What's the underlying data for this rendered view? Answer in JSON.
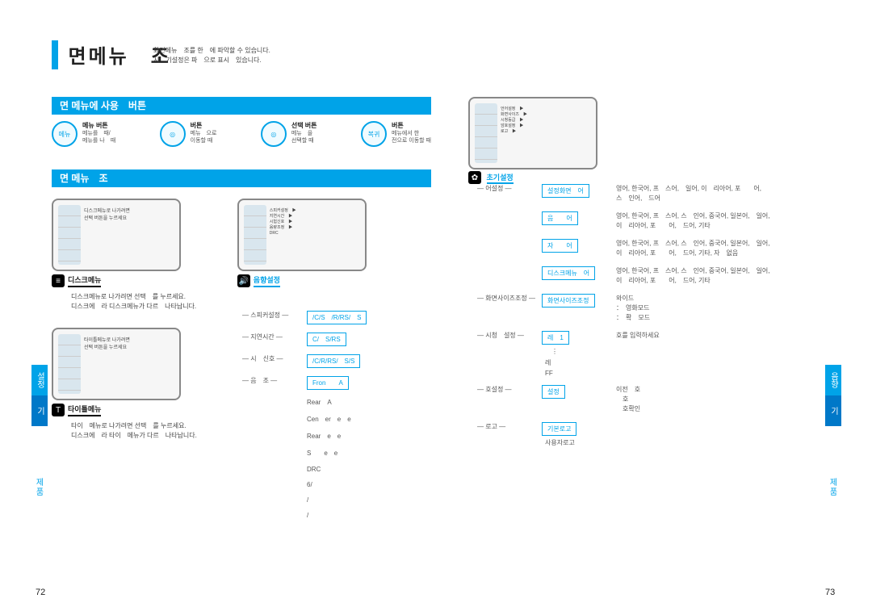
{
  "title": {
    "main": "면메뉴　조",
    "sub1": "화면메뉴　조를 한　에 파악할 수 있습니다.",
    "sub2": "시　기설정은 파　으로 표시　있습니다."
  },
  "section1": {
    "heading": "면 메뉴에 사용　버튼",
    "items": [
      {
        "icon": "메뉴",
        "title": "메뉴 버튼",
        "line1": "메뉴를　때/",
        "line2": "메뉴를 나　때"
      },
      {
        "icon": "◎",
        "title": "버튼",
        "line1": "메뉴　으로",
        "line2": "이동할 때"
      },
      {
        "icon": "◎",
        "title": "선택 버튼",
        "line1": "메뉴　을",
        "line2": "선택할 때"
      },
      {
        "icon": "복귀",
        "title": "버튼",
        "line1": "메뉴에서 한",
        "line2": "전으로 이동할 때"
      }
    ]
  },
  "section2": {
    "heading": "면 메뉴　조"
  },
  "disk": {
    "label": "디스크메뉴",
    "note1": "디스크메뉴로 나가려면 선택　를 누르세요.",
    "note2": "디스크에　라 디스크메뉴가 다르　나타납니다."
  },
  "titleMenu": {
    "label": "타이틀메뉴",
    "note1": "타이　메뉴로 나가려면 선택　를 누르세요.",
    "note2": "디스크에　라 타이　메뉴가 다르　나타납니다."
  },
  "sound": {
    "label": "음향설정",
    "rows": [
      {
        "k": "스피커설정",
        "v": "/C/S　/R/RS/　S"
      },
      {
        "k": "지연시간",
        "v": "C/　S/RS"
      },
      {
        "k": "시　신호",
        "v": "/C/R/RS/　S/S"
      },
      {
        "k": "음　조",
        "v": "Fron　　A"
      },
      {
        "k": "",
        "v": "Rear　A"
      },
      {
        "k": "",
        "v": "Cen　er　e　e"
      },
      {
        "k": "",
        "v": "Rear　e　e"
      },
      {
        "k": "",
        "v": "S　　e　e"
      },
      {
        "k": "",
        "v": "DRC"
      },
      {
        "k": "",
        "v": "6/"
      },
      {
        "k": "",
        "v": "/"
      },
      {
        "k": "",
        "v": "/"
      }
    ]
  },
  "init": {
    "label": "초기설정",
    "tree": [
      {
        "a": "어설정",
        "b": "설정화면　어",
        "c": "영어, 한국어, 프　스어,　일어, 이　리아어, 포　　어,\n스　인어,　드어"
      },
      {
        "a": "",
        "b": "음　　어",
        "c": "영어, 한국어, 프　스어, 스　인어, 중국어, 일본어,　일어,\n이　리아어, 포　　어,　드어, 기타"
      },
      {
        "a": "",
        "b": "자　　어",
        "c": "영어, 한국어, 프　스어, 스　인어, 중국어, 일본어,　일어,\n이　리아어, 포　　어,　드어, 기타, 자　없음"
      },
      {
        "a": "",
        "b": "디스크메뉴　어",
        "c": "영어, 한국어, 프　스어, 스　인어, 중국어, 일본어,　일어,\n이　리아어, 포　　어,　드어, 기타"
      },
      {
        "a": "화면사이즈조정",
        "b": "화면사이즈조정",
        "c": "와이드\n：　영화모드\n：　확　모드"
      },
      {
        "a": "시청　설정",
        "b": "레　1\n　⋮\n레\nFF",
        "c": "호를 입력하세요"
      },
      {
        "a": "호설정",
        "b": "설정",
        "c": "이전　호\n　호\n　호확인"
      },
      {
        "a": "로고",
        "b": "기본로고\n사용자로고",
        "c": ""
      }
    ]
  },
  "sideTab": {
    "topL": "설정",
    "botL": "기",
    "lab": "제품",
    "topR": "음향",
    "botR": "기"
  },
  "pages": {
    "left": "72",
    "right": "73"
  }
}
